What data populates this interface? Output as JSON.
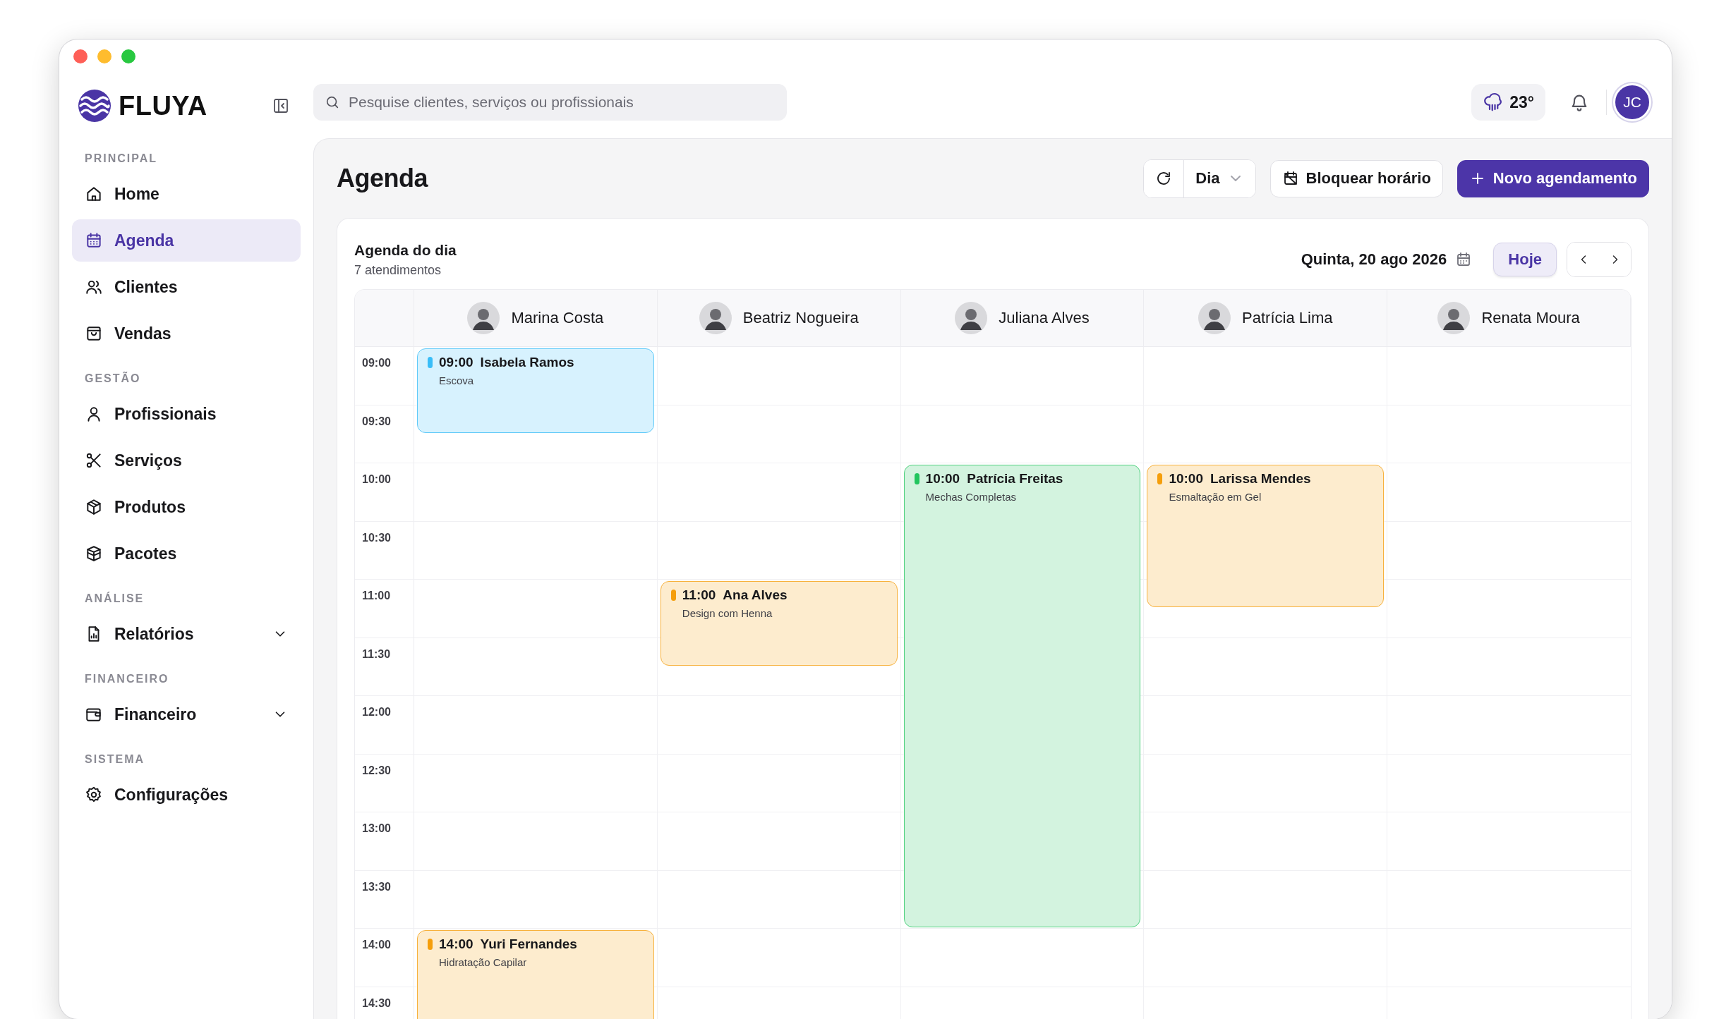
{
  "brand": {
    "name": "FLUYA"
  },
  "search": {
    "placeholder": "Pesquise clientes, serviços ou profissionais"
  },
  "weather": {
    "temperature": "23°"
  },
  "user": {
    "initials": "JC"
  },
  "sidebar": {
    "sections": [
      {
        "title": "PRINCIPAL",
        "items": [
          {
            "label": "Home",
            "selected": false
          },
          {
            "label": "Agenda",
            "selected": true
          },
          {
            "label": "Clientes",
            "selected": false
          },
          {
            "label": "Vendas",
            "selected": false
          }
        ]
      },
      {
        "title": "GESTÃO",
        "items": [
          {
            "label": "Profissionais",
            "selected": false
          },
          {
            "label": "Serviços",
            "selected": false
          },
          {
            "label": "Produtos",
            "selected": false
          },
          {
            "label": "Pacotes",
            "selected": false
          }
        ]
      },
      {
        "title": "ANÁLISE",
        "items": [
          {
            "label": "Relatórios",
            "selected": false,
            "expanded": false
          }
        ]
      },
      {
        "title": "FINANCEIRO",
        "items": [
          {
            "label": "Financeiro",
            "selected": false,
            "expanded": false
          }
        ]
      },
      {
        "title": "SISTEMA",
        "items": [
          {
            "label": "Configurações",
            "selected": false
          }
        ]
      }
    ]
  },
  "page": {
    "title": "Agenda",
    "view": "Dia",
    "block_button": "Bloquear horário",
    "new_button": "Novo agendamento"
  },
  "agenda": {
    "title": "Agenda do dia",
    "subtitle": "7 atendimentos",
    "date": "Quinta, 20 ago 2026",
    "today_button": "Hoje",
    "times": [
      "09:00",
      "09:30",
      "10:00",
      "10:30",
      "11:00",
      "11:30",
      "12:00",
      "12:30",
      "13:00",
      "13:30",
      "14:00",
      "14:30"
    ],
    "professionals": [
      {
        "name": "Marina Costa",
        "appointments": [
          {
            "time": "09:00",
            "client": "Isabela Ramos",
            "service": "Escova",
            "kind": "short",
            "color": "#38bdf8"
          },
          {
            "time": "14:00",
            "client": "Yuri Fernandes",
            "service": "Hidratação Capilar",
            "kind": "medium",
            "color": "#f59e0b"
          }
        ]
      },
      {
        "name": "Beatriz Nogueira",
        "appointments": [
          {
            "time": "11:00",
            "client": "Ana Alves",
            "service": "Design com Henna",
            "kind": "short",
            "color": "#f59e0b"
          }
        ]
      },
      {
        "name": "Juliana Alves",
        "appointments": [
          {
            "time": "10:00",
            "client": "Patrícia Freitas",
            "service": "Mechas Completas",
            "kind": "full",
            "color": "#22c55e"
          }
        ]
      },
      {
        "name": "Patrícia Lima",
        "appointments": [
          {
            "time": "10:00",
            "client": "Larissa Mendes",
            "service": "Esmaltação em Gel",
            "kind": "long",
            "color": "#f59e0b"
          }
        ]
      },
      {
        "name": "Renata Moura"
      }
    ]
  }
}
